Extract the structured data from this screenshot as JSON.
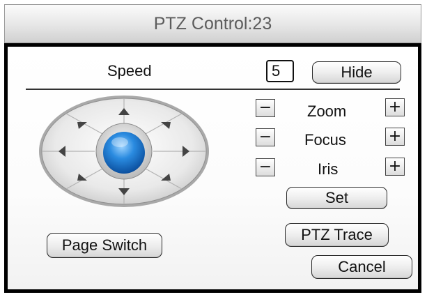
{
  "window": {
    "title": "PTZ Control:23"
  },
  "speed": {
    "label": "Speed",
    "value": "5"
  },
  "buttons": {
    "hide": "Hide",
    "set": "Set",
    "ptz_trace": "PTZ Trace",
    "page_switch": "Page Switch",
    "cancel": "Cancel"
  },
  "adjust": [
    {
      "label": "Zoom",
      "minus": "−",
      "plus": "+"
    },
    {
      "label": "Focus",
      "minus": "−",
      "plus": "+"
    },
    {
      "label": "Iris",
      "minus": "−",
      "plus": "+"
    }
  ],
  "joystick": {
    "directions": [
      "up",
      "up-right",
      "right",
      "down-right",
      "down",
      "down-left",
      "left",
      "up-left"
    ],
    "center_color": "#1f7fd6"
  }
}
